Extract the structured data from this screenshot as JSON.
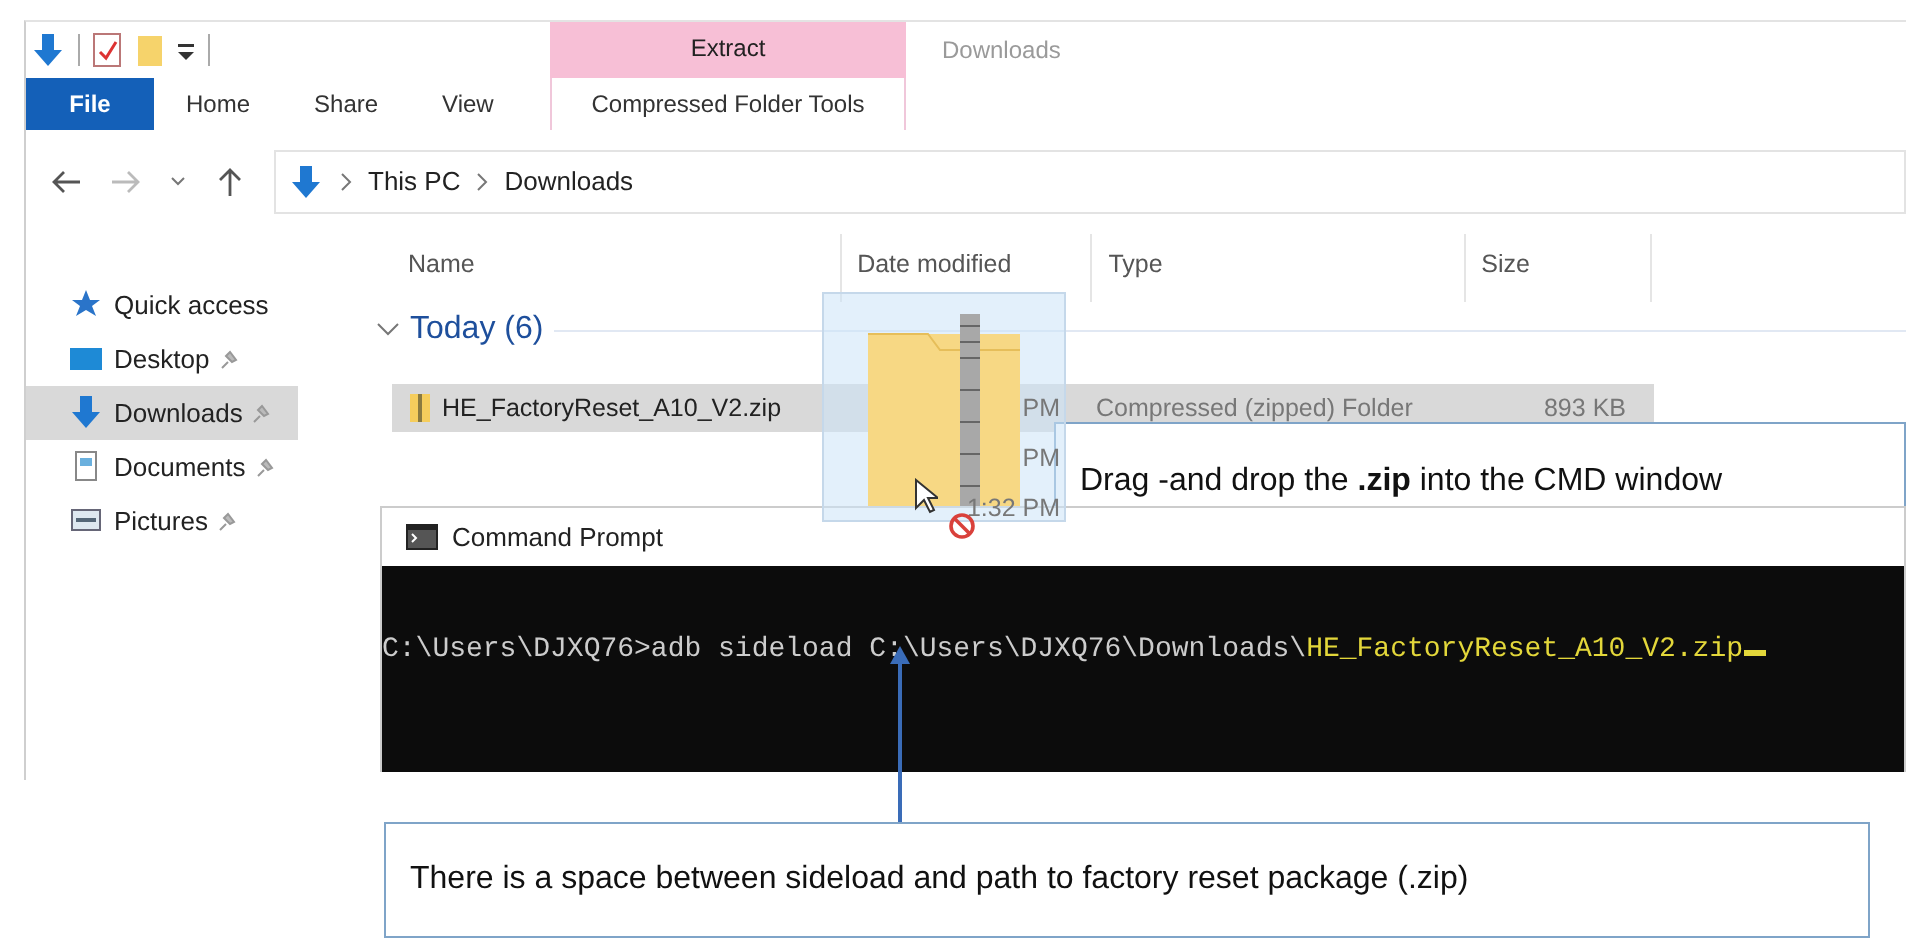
{
  "ribbon": {
    "tabs": [
      {
        "label": "File",
        "kind": "file"
      },
      {
        "label": "Home",
        "kind": "tab"
      },
      {
        "label": "Share",
        "kind": "tab"
      },
      {
        "label": "View",
        "kind": "tab"
      },
      {
        "label": "Compressed Folder Tools",
        "kind": "context"
      }
    ],
    "context_group": "Extract",
    "window_title": "Downloads"
  },
  "address": {
    "path": [
      "This PC",
      "Downloads"
    ]
  },
  "nav": [
    {
      "label": "Quick access",
      "kind": "star",
      "pinned": false,
      "selected": false
    },
    {
      "label": "Desktop",
      "kind": "desktop",
      "pinned": true,
      "selected": false
    },
    {
      "label": "Downloads",
      "kind": "download",
      "pinned": true,
      "selected": true
    },
    {
      "label": "Documents",
      "kind": "documents",
      "pinned": true,
      "selected": false
    },
    {
      "label": "Pictures",
      "kind": "pictures",
      "pinned": true,
      "selected": false
    }
  ],
  "columns": [
    "Name",
    "Date modified",
    "Type",
    "Size"
  ],
  "group": {
    "label": "Today (6)",
    "expanded": true
  },
  "rows": [
    {
      "name": "HE_FactoryReset_A10_V2.zip",
      "date": "PM",
      "type": "Compressed (zipped) Folder",
      "size": "893 KB",
      "selected": true
    },
    {
      "date": "PM",
      "selected": false
    },
    {
      "date": "1:32 PM",
      "selected": false
    }
  ],
  "cmd": {
    "title": "Command Prompt",
    "prompt": "C:\\Users\\DJXQ76>adb sideload C:\\Users\\DJXQ76\\Downloads\\",
    "dropped": "HE_FactoryReset_A10_V2.zip"
  },
  "callouts": [
    "Drag -and drop the **.zip** into the CMD window",
    "There is a space between sideload and path to factory reset package (.zip)"
  ]
}
